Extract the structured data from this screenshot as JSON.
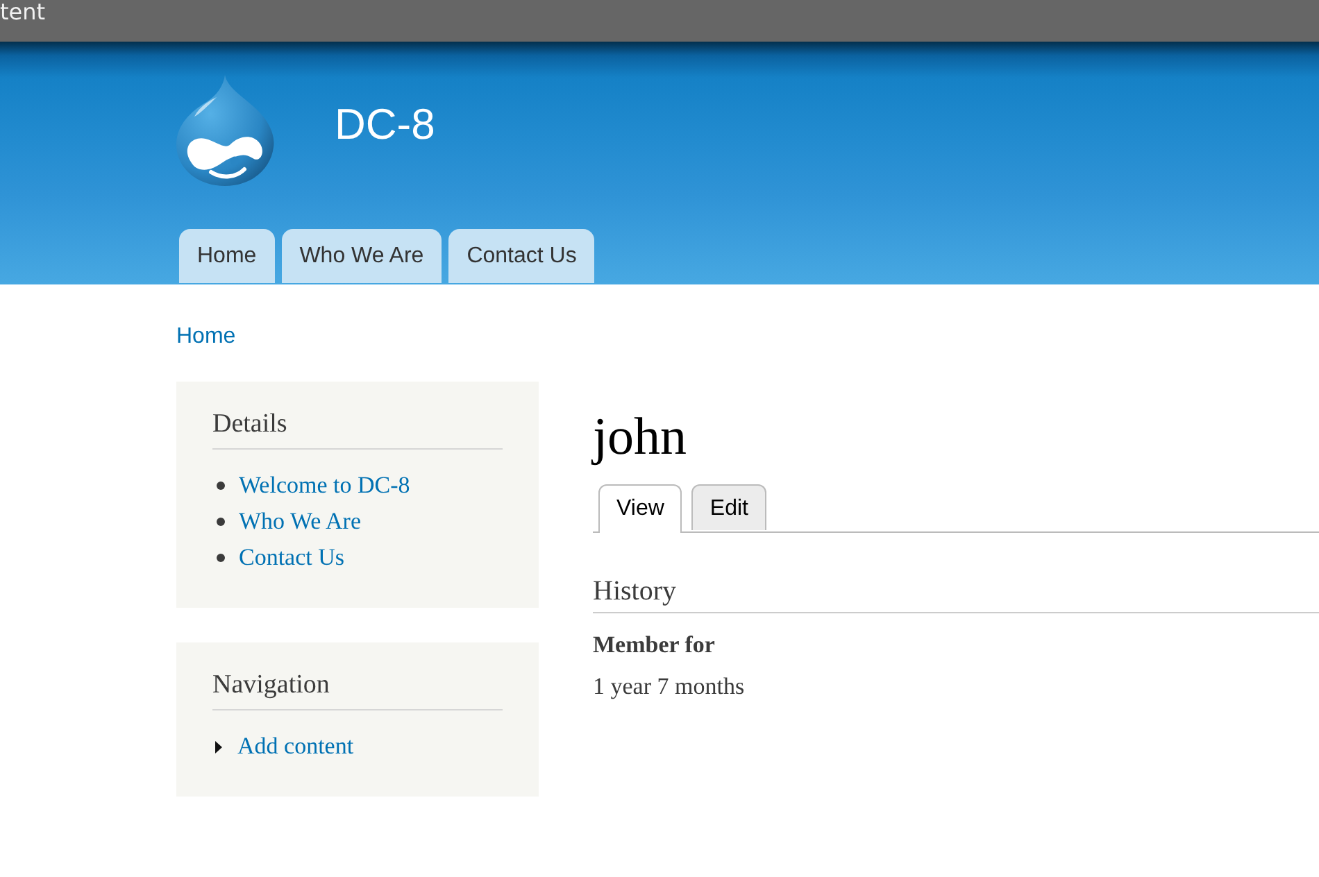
{
  "toolbar": {
    "text": "tent"
  },
  "header": {
    "site_name": "DC-8",
    "nav": [
      {
        "label": "Home",
        "selected": false
      },
      {
        "label": "Who We Are",
        "selected": false
      },
      {
        "label": "Contact Us",
        "selected": false
      }
    ]
  },
  "breadcrumb": [
    {
      "label": "Home"
    }
  ],
  "sidebar": {
    "blocks": [
      {
        "title": "Details",
        "kind": "bullets",
        "items": [
          {
            "label": "Welcome to DC-8"
          },
          {
            "label": "Who We Are"
          },
          {
            "label": "Contact Us"
          }
        ]
      },
      {
        "title": "Navigation",
        "kind": "menu",
        "items": [
          {
            "label": "Add content",
            "expanded": false
          }
        ]
      }
    ]
  },
  "main": {
    "title": "john",
    "tabs": [
      {
        "label": "View",
        "selected": true
      },
      {
        "label": "Edit",
        "selected": false
      }
    ],
    "sections": [
      {
        "heading": "History",
        "fields": [
          {
            "label": "Member for",
            "value": "1 year 7 months"
          }
        ]
      }
    ]
  }
}
